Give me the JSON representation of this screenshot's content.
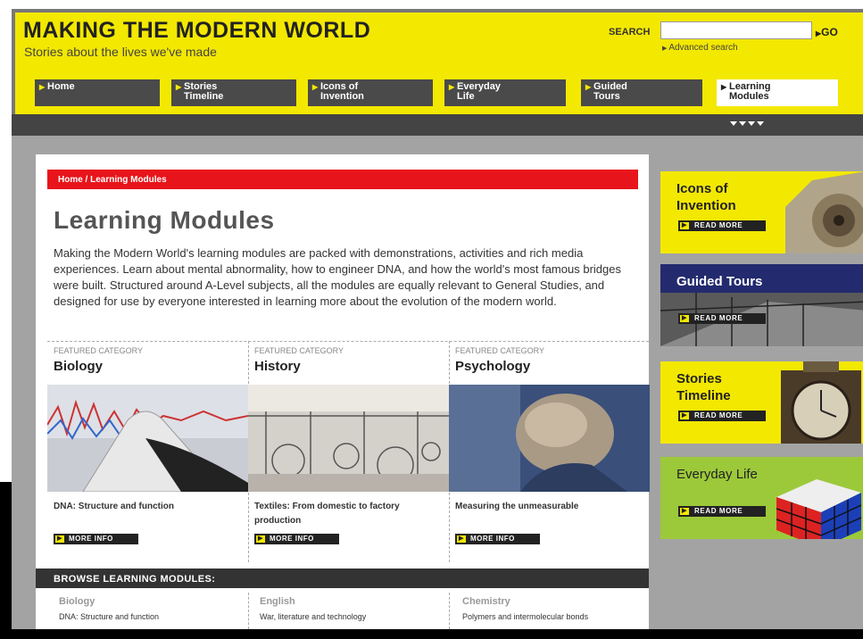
{
  "site": {
    "title": "MAKING THE MODERN WORLD",
    "subtitle": "Stories about the lives we've made"
  },
  "search": {
    "label": "SEARCH",
    "placeholder": "",
    "go_label": "GO",
    "advanced_label": "Advanced search"
  },
  "nav": {
    "items": [
      {
        "label": "Home"
      },
      {
        "label": "Stories Timeline"
      },
      {
        "label": "Icons of Invention"
      },
      {
        "label": "Everyday Life"
      },
      {
        "label": "Guided Tours"
      },
      {
        "label": "Learning Modules"
      }
    ]
  },
  "breadcrumb": "Home / Learning Modules",
  "page": {
    "title": "Learning Modules",
    "intro": "Making the Modern World's learning modules are packed with demonstrations, activities and rich media experiences. Learn about mental abnormality, how to engineer DNA, and how the world's most famous bridges were built. Structured around A-Level subjects, all the modules are equally relevant to General Studies, and designed for use by everyone interested in learning more about the evolution of the modern world."
  },
  "featured": [
    {
      "label": "FEATURED CATEGORY",
      "title": "Biology",
      "desc": "DNA: Structure and function",
      "button": "MORE INFO"
    },
    {
      "label": "FEATURED CATEGORY",
      "title": "History",
      "desc": "Textiles: From domestic to factory production",
      "button": "MORE INFO"
    },
    {
      "label": "FEATURED CATEGORY",
      "title": "Psychology",
      "desc": "Measuring the unmeasurable",
      "button": "MORE INFO"
    }
  ],
  "browse": {
    "heading": "BROWSE LEARNING MODULES:",
    "columns": [
      {
        "category": "Biology",
        "module": "DNA: Structure and function"
      },
      {
        "category": "English",
        "module": "War, literature and technology"
      },
      {
        "category": "Chemistry",
        "module": "Polymers and intermolecular bonds"
      }
    ]
  },
  "sidebar": [
    {
      "title": "Icons of Invention",
      "button": "READ MORE",
      "bg": "#f3e800",
      "color": "#222"
    },
    {
      "title": "Guided Tours",
      "button": "READ MORE",
      "bg": "#232a6e",
      "color": "#fff"
    },
    {
      "title": "Stories Timeline",
      "button": "READ MORE",
      "bg": "#f3e800",
      "color": "#222"
    },
    {
      "title": "Everyday Life",
      "button": "READ MORE",
      "bg": "#9cc93a",
      "color": "#222"
    }
  ],
  "colors": {
    "brand_yellow": "#f3e800",
    "breadcrumb_red": "#e8141b",
    "nav_dark": "#4a4a4a"
  }
}
